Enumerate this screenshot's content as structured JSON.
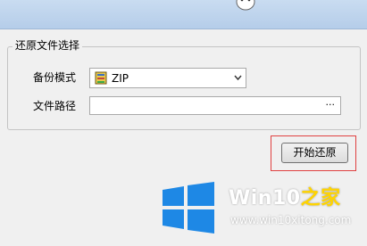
{
  "group": {
    "title": "还原文件选择"
  },
  "backup_mode": {
    "label": "备份模式",
    "value": "ZIP",
    "icon": "zip-archive-icon"
  },
  "file_path": {
    "label": "文件路径",
    "value": "",
    "browse_label": "···"
  },
  "actions": {
    "start_restore": "开始还原"
  },
  "watermark": {
    "brand_main": "Win10",
    "brand_accent": "之家",
    "url": "www.win10xitong.com"
  },
  "colors": {
    "highlight_border": "#e04040",
    "brand_accent": "#ffd400",
    "logo_blue": "#1e88e5"
  }
}
